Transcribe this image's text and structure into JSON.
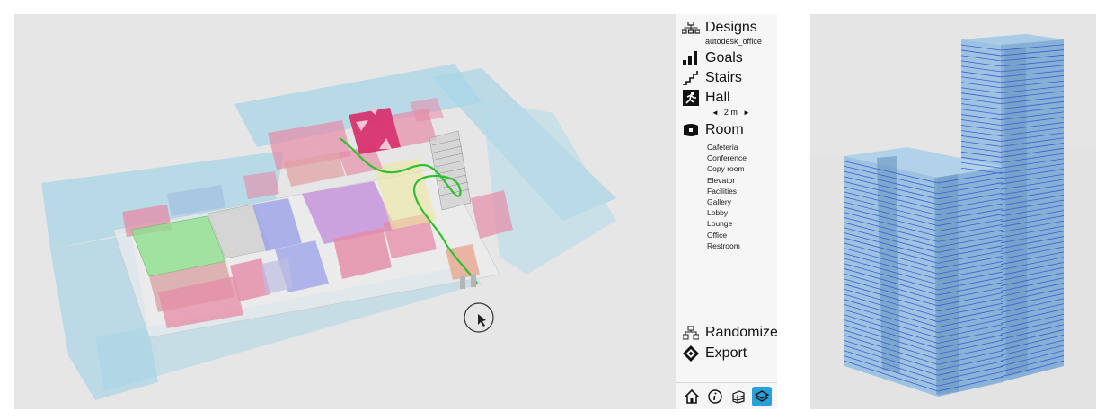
{
  "sidebar": {
    "designs": {
      "label": "Designs",
      "subtitle": "autodesk_office",
      "icon": "hierarchy-icon"
    },
    "goals": {
      "label": "Goals",
      "icon": "bar-chart-icon"
    },
    "stairs": {
      "label": "Stairs",
      "icon": "stairs-icon"
    },
    "hall": {
      "label": "Hall",
      "icon": "exit-icon",
      "value": "2 m",
      "decrease": "◄",
      "increase": "►"
    },
    "room": {
      "label": "Room",
      "icon": "room-icon",
      "items": [
        "Cafeteria",
        "Conference",
        "Copy room",
        "Elevator",
        "Facilities",
        "Gallery",
        "Lobby",
        "Lounge",
        "Office",
        "Restroom"
      ]
    },
    "randomize": {
      "label": "Randomize",
      "icon": "shuffle-icon"
    },
    "export": {
      "label": "Export",
      "icon": "export-icon"
    }
  },
  "toolbar": {
    "buttons": [
      {
        "icon": "home-icon"
      },
      {
        "icon": "info-icon"
      },
      {
        "icon": "building-icon"
      },
      {
        "icon": "layers-icon",
        "active": true
      }
    ]
  },
  "colors": {
    "accent": "#2aa0d8",
    "room_pink": "#e58ba6",
    "room_magenta": "#d8336e",
    "room_purple": "#c08ad8",
    "room_green": "#8fe08f",
    "room_blue": "#9aa2e8",
    "circulation": "#a8d4e6",
    "path": "#2ec02e",
    "tower": "#8fb8d8",
    "floor_lines": "#3e5fd0"
  }
}
